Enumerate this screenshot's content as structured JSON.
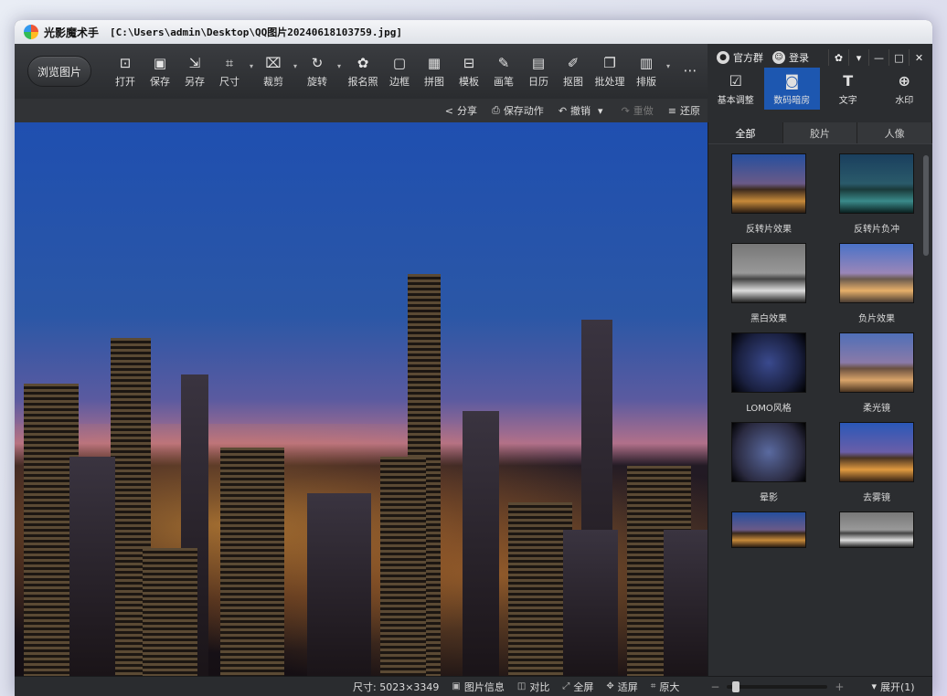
{
  "window": {
    "app_title": "光影魔术手",
    "file_path": "[C:\\Users\\admin\\Desktop\\QQ图片20240618103759.jpg]"
  },
  "toolbar": {
    "browse_label": "浏览图片",
    "tools": [
      {
        "label": "打开",
        "icon": "open-icon",
        "glyph": "⊡"
      },
      {
        "label": "保存",
        "icon": "save-icon",
        "glyph": "▣"
      },
      {
        "label": "另存",
        "icon": "save-as-icon",
        "glyph": "⇲"
      },
      {
        "label": "尺寸",
        "icon": "resize-icon",
        "glyph": "⌗",
        "caret": true
      },
      {
        "label": "裁剪",
        "icon": "crop-icon",
        "glyph": "⌧",
        "caret": true
      },
      {
        "label": "旋转",
        "icon": "rotate-icon",
        "glyph": "↻",
        "caret": true
      },
      {
        "label": "报名照",
        "icon": "id-photo-icon",
        "glyph": "✿"
      },
      {
        "label": "边框",
        "icon": "frame-icon",
        "glyph": "▢"
      },
      {
        "label": "拼图",
        "icon": "collage-icon",
        "glyph": "▦"
      },
      {
        "label": "模板",
        "icon": "template-icon",
        "glyph": "⊟"
      },
      {
        "label": "画笔",
        "icon": "brush-icon",
        "glyph": "✎"
      },
      {
        "label": "日历",
        "icon": "calendar-icon",
        "glyph": "▤"
      },
      {
        "label": "抠图",
        "icon": "cutout-icon",
        "glyph": "✐"
      },
      {
        "label": "批处理",
        "icon": "batch-icon",
        "glyph": "❐"
      },
      {
        "label": "排版",
        "icon": "layout-icon",
        "glyph": "▥",
        "caret": true
      },
      {
        "label": "",
        "icon": "more-icon",
        "glyph": "⋯"
      }
    ]
  },
  "header_links": {
    "official_group": "官方群",
    "login": "登录"
  },
  "edit_tabs": [
    {
      "label": "基本调整",
      "icon": "basic-adjust-icon",
      "glyph": "☑"
    },
    {
      "label": "数码暗房",
      "icon": "darkroom-icon",
      "glyph": "◙",
      "active": true
    },
    {
      "label": "文字",
      "icon": "text-icon",
      "glyph": "T"
    },
    {
      "label": "水印",
      "icon": "watermark-icon",
      "glyph": "⊕"
    }
  ],
  "subbar": {
    "share": "分享",
    "save_action": "保存动作",
    "undo": "撤销",
    "redo": "重做",
    "restore": "还原"
  },
  "panel": {
    "tabs": [
      "全部",
      "胶片",
      "人像"
    ],
    "effects": [
      {
        "label": "反转片效果",
        "style": ""
      },
      {
        "label": "反转片负冲",
        "style": "neg"
      },
      {
        "label": "黑白效果",
        "style": "bw"
      },
      {
        "label": "负片效果",
        "style": "negfx"
      },
      {
        "label": "LOMO风格",
        "style": "lomo"
      },
      {
        "label": "柔光镜",
        "style": "soft"
      },
      {
        "label": "晕影",
        "style": "vig"
      },
      {
        "label": "去雾镜",
        "style": "fog"
      },
      {
        "label": "",
        "style": "partial"
      },
      {
        "label": "",
        "style": "partial bw"
      }
    ]
  },
  "statusbar": {
    "size": "尺寸: 5023×3349",
    "info": "图片信息",
    "compare": "对比",
    "fullscreen": "全屏",
    "fit": "适屏",
    "original": "原大",
    "zoom_level": 0.05,
    "expand": "展开(1)"
  }
}
